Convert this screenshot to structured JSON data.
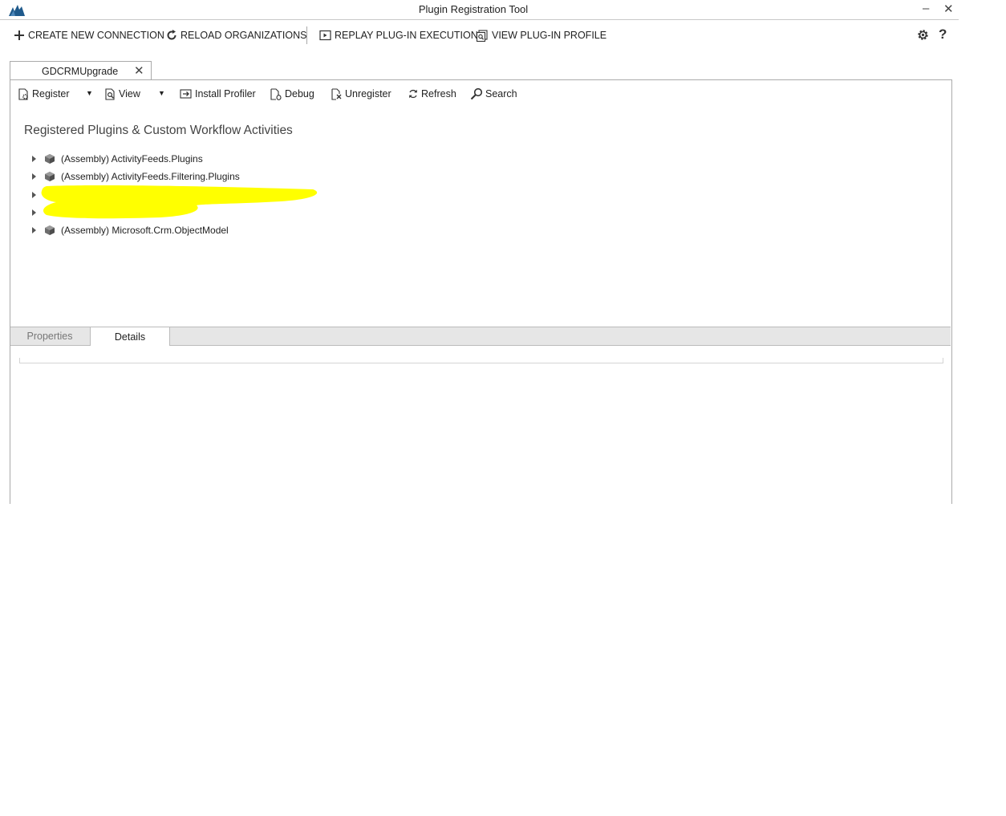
{
  "window": {
    "title": "Plugin Registration Tool",
    "minimize_label": "–",
    "close_label": "✕"
  },
  "commands": {
    "create_connection": "CREATE NEW CONNECTION",
    "reload_organizations": "RELOAD ORGANIZATIONS",
    "replay_execution": "REPLAY PLUG-IN EXECUTION",
    "view_profile": "VIEW PLUG-IN PROFILE"
  },
  "connection_tab": {
    "label": "GDCRMUpgrade",
    "close_label": "✕"
  },
  "toolbar": {
    "register": "Register",
    "view": "View",
    "install_profiler": "Install Profiler",
    "debug": "Debug",
    "unregister": "Unregister",
    "refresh": "Refresh",
    "search": "Search"
  },
  "section_title": "Registered Plugins & Custom Workflow Activities",
  "tree": [
    {
      "label": "(Assembly) ActivityFeeds.Plugins"
    },
    {
      "label": "(Assembly) ActivityFeeds.Filtering.Plugins"
    },
    {
      "label": "(Assembly) Microsoft.Crm.ObjectModel"
    }
  ],
  "bottom_tabs": {
    "properties": "Properties",
    "details": "Details",
    "active": "Details"
  },
  "colors": {
    "highlight": "#ffff00",
    "border": "#aaaaaa",
    "logo": "#1f5a8c"
  }
}
